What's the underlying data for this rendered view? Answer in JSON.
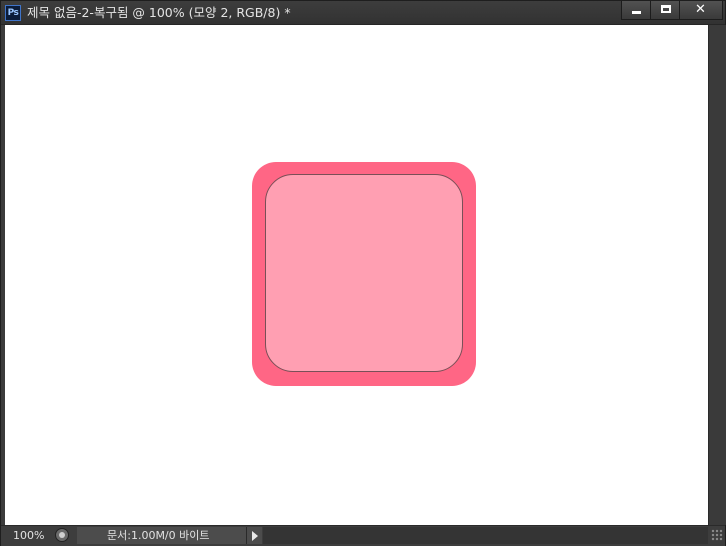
{
  "window": {
    "app_icon_label": "Ps",
    "title": "제목 없음-2-복구됨 @ 100% (모양 2, RGB/8) *",
    "controls": {
      "minimize_icon": "minimize-icon",
      "maximize_icon": "maximize-icon",
      "close_glyph": "✕"
    }
  },
  "canvas": {
    "background": "#ffffff",
    "shape": {
      "outer_color": "#ff6685",
      "inner_color": "#ff9fb2",
      "inner_stroke_color": "#7a4f57"
    }
  },
  "statusbar": {
    "zoom": "100%",
    "doc_info": "문서:1.00M/0 바이트"
  }
}
